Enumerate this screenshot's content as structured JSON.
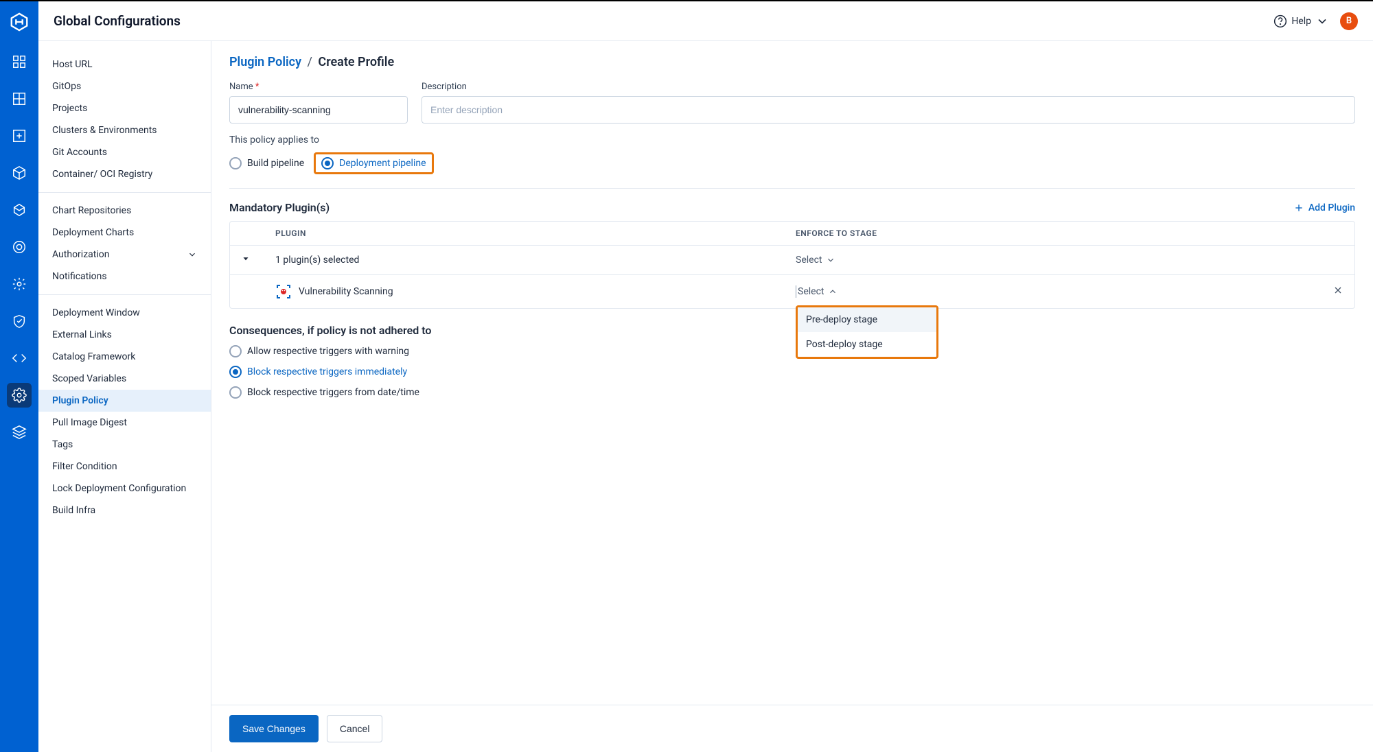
{
  "topbar": {
    "title": "Global Configurations",
    "help_label": "Help",
    "avatar_initial": "B"
  },
  "sidebar": {
    "groups": [
      {
        "items": [
          "Host URL",
          "GitOps",
          "Projects",
          "Clusters & Environments",
          "Git Accounts",
          "Container/ OCI Registry"
        ]
      },
      {
        "items": [
          "Chart Repositories",
          "Deployment Charts",
          "Authorization",
          "Notifications"
        ],
        "expandable_index": 2
      },
      {
        "items": [
          "Deployment Window",
          "External Links",
          "Catalog Framework",
          "Scoped Variables",
          "Plugin Policy",
          "Pull Image Digest",
          "Tags",
          "Filter Condition",
          "Lock Deployment Configuration",
          "Build Infra"
        ],
        "active_index": 4
      }
    ]
  },
  "breadcrumb": {
    "root": "Plugin Policy",
    "sep": "/",
    "current": "Create Profile"
  },
  "form": {
    "name_label": "Name",
    "name_value": "vulnerability-scanning",
    "desc_label": "Description",
    "desc_placeholder": "Enter description",
    "applies_label": "This policy applies to",
    "radio_build": "Build pipeline",
    "radio_deploy": "Deployment pipeline"
  },
  "plugins": {
    "section_title": "Mandatory Plugin(s)",
    "add_label": "Add Plugin",
    "col_plugin": "PLUGIN",
    "col_stage": "ENFORCE TO STAGE",
    "selected_summary": "1 plugin(s) selected",
    "select_label": "Select",
    "row_plugin_name": "Vulnerability Scanning",
    "dropdown_options": [
      "Pre-deploy stage",
      "Post-deploy stage"
    ]
  },
  "consequences": {
    "title": "Consequences, if policy is not adhered to",
    "options": [
      "Allow respective triggers with warning",
      "Block respective triggers immediately",
      "Block respective triggers from date/time"
    ],
    "selected_index": 1
  },
  "footer": {
    "save": "Save Changes",
    "cancel": "Cancel"
  }
}
